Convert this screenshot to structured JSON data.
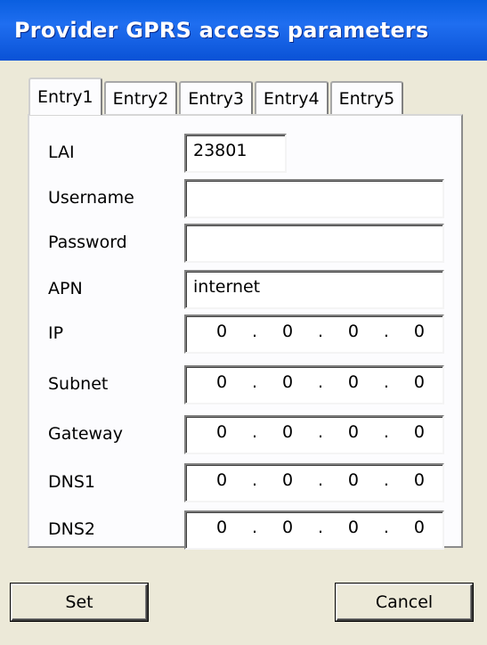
{
  "window": {
    "title": "Provider GPRS access parameters"
  },
  "tabs": [
    "Entry1",
    "Entry2",
    "Entry3",
    "Entry4",
    "Entry5"
  ],
  "active_tab": "Entry1",
  "fields": [
    {
      "label": "LAI",
      "value": "23801"
    },
    {
      "label": "Username",
      "value": ""
    },
    {
      "label": "Password",
      "value": ""
    },
    {
      "label": "APN",
      "value": "internet"
    },
    {
      "label": "IP",
      "octets": [
        "0",
        "0",
        "0",
        "0"
      ]
    },
    {
      "label": "Subnet",
      "octets": [
        "0",
        "0",
        "0",
        "0"
      ]
    },
    {
      "label": "Gateway",
      "octets": [
        "0",
        "0",
        "0",
        "0"
      ]
    },
    {
      "label": "DNS1",
      "octets": [
        "0",
        "0",
        "0",
        "0"
      ]
    },
    {
      "label": "DNS2",
      "octets": [
        "0",
        "0",
        "0",
        "0"
      ]
    }
  ],
  "ip_separator": ".",
  "buttons": {
    "set_label": "Set",
    "cancel_label": "Cancel"
  }
}
